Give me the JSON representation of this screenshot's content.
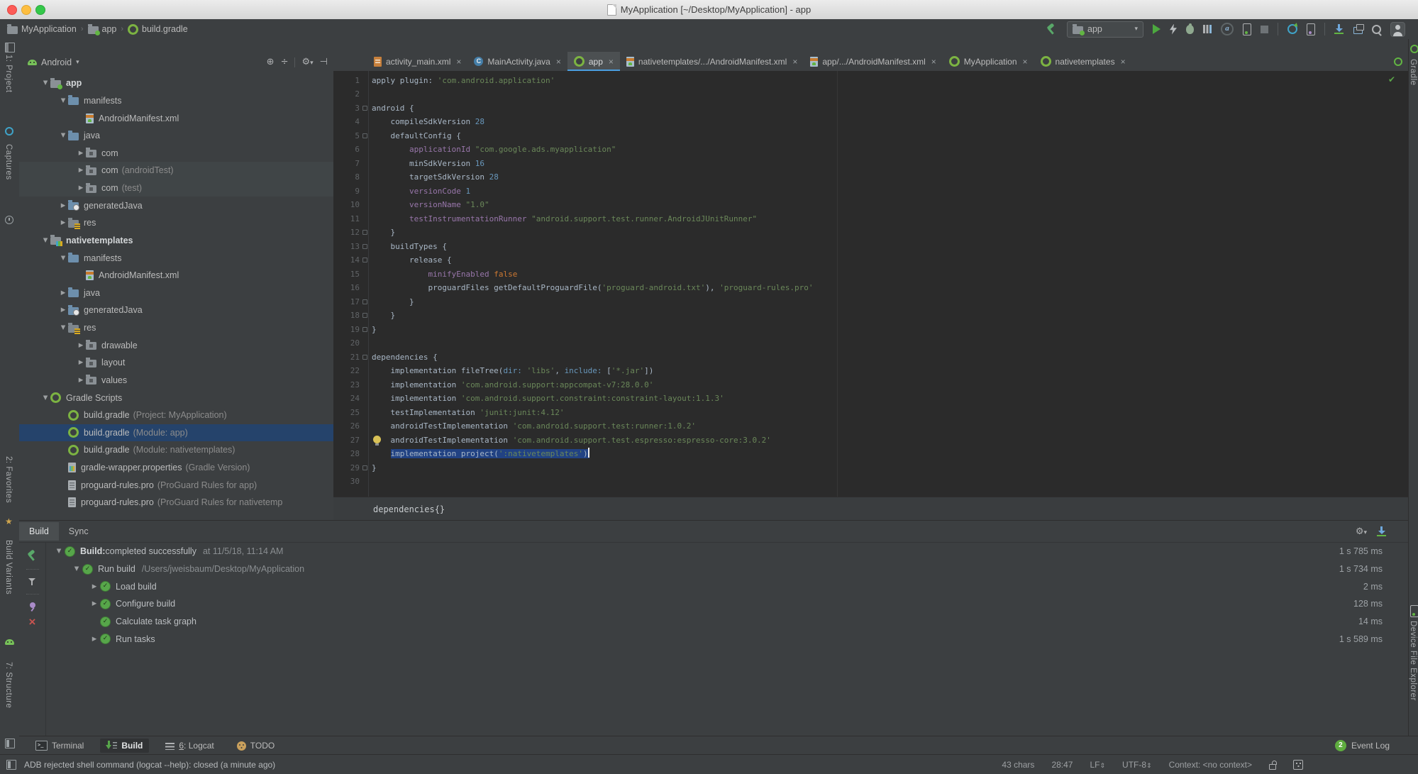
{
  "window": {
    "title": "MyApplication [~/Desktop/MyApplication] - app"
  },
  "breadcrumbs": [
    {
      "label": "MyApplication",
      "icon": "folder-grey"
    },
    {
      "label": "app",
      "icon": "module-app"
    },
    {
      "label": "build.gradle",
      "icon": "gradle"
    }
  ],
  "toolbar": {
    "run_config": "app"
  },
  "project_panel": {
    "view_selector": "Android",
    "tree": [
      {
        "indent": 1,
        "arrow": "v",
        "icon": "module-app",
        "label": "app",
        "bold": true
      },
      {
        "indent": 2,
        "arrow": "v",
        "icon": "folder",
        "label": "manifests"
      },
      {
        "indent": 3,
        "arrow": "",
        "icon": "manifest",
        "label": "AndroidManifest.xml"
      },
      {
        "indent": 2,
        "arrow": "v",
        "icon": "folder",
        "label": "java"
      },
      {
        "indent": 3,
        "arrow": ">",
        "icon": "package",
        "label": "com"
      },
      {
        "indent": 3,
        "arrow": ">",
        "icon": "package",
        "label": "com",
        "note": "(androidTest)",
        "hl": true
      },
      {
        "indent": 3,
        "arrow": ">",
        "icon": "package",
        "label": "com",
        "note": "(test)",
        "hl": true
      },
      {
        "indent": 2,
        "arrow": ">",
        "icon": "gen",
        "label": "generatedJava"
      },
      {
        "indent": 2,
        "arrow": ">",
        "icon": "res",
        "label": "res"
      },
      {
        "indent": 1,
        "arrow": "v",
        "icon": "module-lib",
        "label": "nativetemplates",
        "bold": true
      },
      {
        "indent": 2,
        "arrow": "v",
        "icon": "folder",
        "label": "manifests"
      },
      {
        "indent": 3,
        "arrow": "",
        "icon": "manifest",
        "label": "AndroidManifest.xml"
      },
      {
        "indent": 2,
        "arrow": ">",
        "icon": "folder",
        "label": "java"
      },
      {
        "indent": 2,
        "arrow": ">",
        "icon": "gen",
        "label": "generatedJava"
      },
      {
        "indent": 2,
        "arrow": "v",
        "icon": "res",
        "label": "res"
      },
      {
        "indent": 3,
        "arrow": ">",
        "icon": "package",
        "label": "drawable"
      },
      {
        "indent": 3,
        "arrow": ">",
        "icon": "package",
        "label": "layout"
      },
      {
        "indent": 3,
        "arrow": ">",
        "icon": "package",
        "label": "values"
      },
      {
        "indent": 1,
        "arrow": "v",
        "icon": "gradle",
        "label": "Gradle Scripts"
      },
      {
        "indent": 2,
        "arrow": "",
        "icon": "gradle",
        "label": "build.gradle",
        "note": "(Project: MyApplication)"
      },
      {
        "indent": 2,
        "arrow": "",
        "icon": "gradle",
        "label": "build.gradle",
        "note": "(Module: app)",
        "sel": true
      },
      {
        "indent": 2,
        "arrow": "",
        "icon": "gradle",
        "label": "build.gradle",
        "note": "(Module: nativetemplates)"
      },
      {
        "indent": 2,
        "arrow": "",
        "icon": "wrapper",
        "label": "gradle-wrapper.properties",
        "note": "(Gradle Version)"
      },
      {
        "indent": 2,
        "arrow": "",
        "icon": "profile-file",
        "label": "proguard-rules.pro",
        "note": "(ProGuard Rules for app)"
      },
      {
        "indent": 2,
        "arrow": "",
        "icon": "profile-file",
        "label": "proguard-rules.pro",
        "note": "(ProGuard Rules for nativetemp"
      }
    ]
  },
  "tabs": [
    {
      "icon": "xmlfile",
      "label": "activity_main.xml"
    },
    {
      "icon": "java",
      "label": "MainActivity.java"
    },
    {
      "icon": "gradle",
      "label": "app",
      "active": true
    },
    {
      "icon": "manifest",
      "label": "nativetemplates/.../AndroidManifest.xml"
    },
    {
      "icon": "manifest",
      "label": "app/.../AndroidManifest.xml"
    },
    {
      "icon": "gradle",
      "label": "MyApplication"
    },
    {
      "icon": "gradle",
      "label": "nativetemplates"
    }
  ],
  "editor": {
    "breadcrumb": "dependencies{}",
    "fold_open_lines": [
      3,
      5,
      13,
      14,
      21
    ],
    "fold_close_lines": [
      12,
      17,
      18,
      19,
      29
    ],
    "bulb_line": 27,
    "lines": [
      {
        "n": 1,
        "segs": [
          [
            "p",
            "apply plugin: "
          ],
          [
            "s",
            "'com.android.application'"
          ]
        ]
      },
      {
        "n": 2,
        "segs": []
      },
      {
        "n": 3,
        "segs": [
          [
            "p",
            "android {"
          ]
        ]
      },
      {
        "n": 4,
        "segs": [
          [
            "p",
            "    compileSdkVersion "
          ],
          [
            "n",
            "28"
          ]
        ]
      },
      {
        "n": 5,
        "segs": [
          [
            "p",
            "    defaultConfig {"
          ]
        ]
      },
      {
        "n": 6,
        "segs": [
          [
            "p",
            "        "
          ],
          [
            "f",
            "applicationId"
          ],
          [
            "p",
            " "
          ],
          [
            "s",
            "\"com.google.ads.myapplication\""
          ]
        ]
      },
      {
        "n": 7,
        "segs": [
          [
            "p",
            "        minSdkVersion "
          ],
          [
            "n",
            "16"
          ]
        ]
      },
      {
        "n": 8,
        "segs": [
          [
            "p",
            "        targetSdkVersion "
          ],
          [
            "n",
            "28"
          ]
        ]
      },
      {
        "n": 9,
        "segs": [
          [
            "p",
            "        "
          ],
          [
            "f",
            "versionCode"
          ],
          [
            "p",
            " "
          ],
          [
            "n",
            "1"
          ]
        ]
      },
      {
        "n": 10,
        "segs": [
          [
            "p",
            "        "
          ],
          [
            "f",
            "versionName"
          ],
          [
            "p",
            " "
          ],
          [
            "s",
            "\"1.0\""
          ]
        ]
      },
      {
        "n": 11,
        "segs": [
          [
            "p",
            "        "
          ],
          [
            "f",
            "testInstrumentationRunner"
          ],
          [
            "p",
            " "
          ],
          [
            "s",
            "\"android.support.test.runner.AndroidJUnitRunner\""
          ]
        ]
      },
      {
        "n": 12,
        "segs": [
          [
            "p",
            "    }"
          ]
        ]
      },
      {
        "n": 13,
        "segs": [
          [
            "p",
            "    buildTypes {"
          ]
        ]
      },
      {
        "n": 14,
        "segs": [
          [
            "p",
            "        release {"
          ]
        ]
      },
      {
        "n": 15,
        "segs": [
          [
            "p",
            "            "
          ],
          [
            "f",
            "minifyEnabled"
          ],
          [
            "p",
            " "
          ],
          [
            "k",
            "false"
          ]
        ]
      },
      {
        "n": 16,
        "segs": [
          [
            "p",
            "            proguardFiles getDefaultProguardFile("
          ],
          [
            "s",
            "'proguard-android.txt'"
          ],
          [
            "p",
            "), "
          ],
          [
            "s",
            "'proguard-rules.pro'"
          ]
        ]
      },
      {
        "n": 17,
        "segs": [
          [
            "p",
            "        }"
          ]
        ]
      },
      {
        "n": 18,
        "segs": [
          [
            "p",
            "    }"
          ]
        ]
      },
      {
        "n": 19,
        "segs": [
          [
            "p",
            "}"
          ]
        ]
      },
      {
        "n": 20,
        "segs": []
      },
      {
        "n": 21,
        "segs": [
          [
            "p",
            "dependencies {"
          ]
        ]
      },
      {
        "n": 22,
        "segs": [
          [
            "p",
            "    implementation fileTree("
          ],
          [
            "a",
            "dir:"
          ],
          [
            "p",
            " "
          ],
          [
            "s",
            "'libs'"
          ],
          [
            "p",
            ", "
          ],
          [
            "a",
            "include:"
          ],
          [
            "p",
            " ["
          ],
          [
            "s",
            "'*.jar'"
          ],
          [
            "p",
            "])"
          ]
        ]
      },
      {
        "n": 23,
        "segs": [
          [
            "p",
            "    implementation "
          ],
          [
            "s",
            "'com.android.support:appcompat-v7:28.0.0'"
          ]
        ]
      },
      {
        "n": 24,
        "segs": [
          [
            "p",
            "    implementation "
          ],
          [
            "s",
            "'com.android.support.constraint:constraint-layout:1.1.3'"
          ]
        ]
      },
      {
        "n": 25,
        "segs": [
          [
            "p",
            "    testImplementation "
          ],
          [
            "s",
            "'junit:junit:4.12'"
          ]
        ]
      },
      {
        "n": 26,
        "segs": [
          [
            "p",
            "    androidTestImplementation "
          ],
          [
            "s",
            "'com.android.support.test:runner:1.0.2'"
          ]
        ]
      },
      {
        "n": 27,
        "segs": [
          [
            "p",
            "    androidTestImplementation "
          ],
          [
            "s",
            "'com.android.support.test.espresso:espresso-core:3.0.2'"
          ]
        ]
      },
      {
        "n": 28,
        "segs": [
          [
            "p",
            "    "
          ]
        ],
        "sel_segs": [
          [
            "p",
            "implementation project("
          ],
          [
            "s",
            "':nativetemplates'"
          ],
          [
            "p",
            ")"
          ]
        ],
        "caret": true
      },
      {
        "n": 29,
        "segs": [
          [
            "p",
            "}"
          ]
        ]
      },
      {
        "n": 30,
        "segs": []
      }
    ]
  },
  "build_panel": {
    "tabs": [
      {
        "label": "Build",
        "active": true
      },
      {
        "label": "Sync"
      }
    ],
    "rows": [
      {
        "indent": 0,
        "arrow": "v",
        "bold": "Build:",
        "label": " completed successfully",
        "note": "at 11/5/18, 11:14 AM",
        "duration": "1 s 785 ms"
      },
      {
        "indent": 1,
        "arrow": "v",
        "label": "Run build",
        "note": "/Users/jweisbaum/Desktop/MyApplication",
        "duration": "1 s 734 ms"
      },
      {
        "indent": 2,
        "arrow": ">",
        "label": "Load build",
        "duration": "2 ms"
      },
      {
        "indent": 2,
        "arrow": ">",
        "label": "Configure build",
        "duration": "128 ms"
      },
      {
        "indent": 2,
        "arrow": "",
        "label": "Calculate task graph",
        "duration": "14 ms"
      },
      {
        "indent": 2,
        "arrow": ">",
        "label": "Run tasks",
        "duration": "1 s 589 ms"
      }
    ]
  },
  "bottom_bar": {
    "items": [
      {
        "icon": "terminal",
        "label": "Terminal"
      },
      {
        "icon": "buildtab",
        "label": "Build",
        "active": true
      },
      {
        "icon": "logcat",
        "mnemonic": "6",
        "label": ": Logcat"
      },
      {
        "icon": "todo",
        "label": "TODO"
      }
    ],
    "event_log": {
      "count": "2",
      "label": "Event Log"
    }
  },
  "status_bar": {
    "message": "ADB rejected shell command (logcat --help): closed (a minute ago)",
    "right_items": [
      {
        "text": "43 chars"
      },
      {
        "text": "28:47"
      },
      {
        "text": "LF",
        "caret": true
      },
      {
        "text": "UTF-8",
        "caret": true
      },
      {
        "text": "Context: <no context>"
      }
    ]
  },
  "stripes": {
    "left_top": [
      "1: Project",
      "Captures"
    ],
    "left_bottom": [
      "2: Favorites",
      "Build Variants",
      "7: Structure"
    ],
    "right": [
      "Gradle",
      "Device File Explorer"
    ]
  },
  "icons": {
    "gear": "⚙",
    "target": "⊕",
    "collapse": "÷",
    "hide": "⊣",
    "caret-down": "▾",
    "tree-expanded": "▼",
    "tree-collapsed": "▶",
    "close": "×",
    "star": "★",
    "check": "✓",
    "updown": "⇕"
  },
  "colors": {
    "panel": "#3C3F41",
    "editor_bg": "#2B2B2B",
    "selection_editor": "#214283",
    "selection_tree": "#25436B",
    "string": "#6A8759",
    "number": "#6897BB",
    "field": "#9876AA",
    "keyword": "#CC7832",
    "plain": "#A9B7C6",
    "tab_underline": "#4A9EDF",
    "run_green": "#4CA93F",
    "ok_green": "#57A64A",
    "event_badge": "#5FAD3F"
  }
}
